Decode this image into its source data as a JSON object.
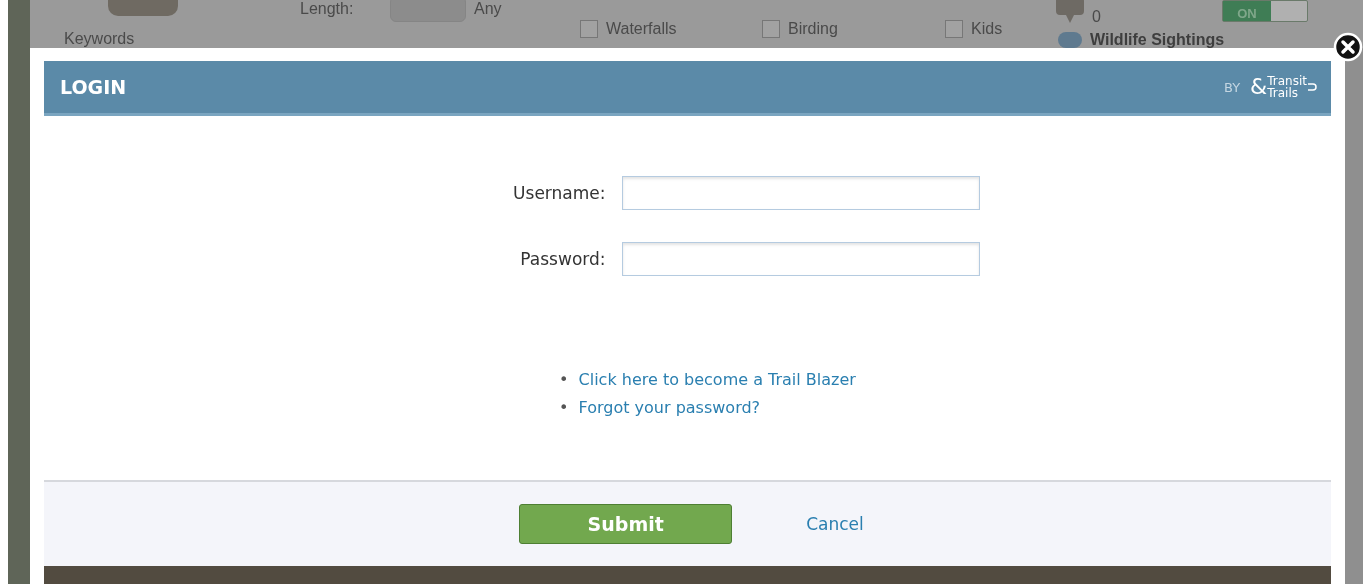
{
  "background_page": {
    "keywords_label": "Keywords",
    "length_label": "Length:",
    "length_value": "Any",
    "categories": [
      {
        "label": "Waterfalls",
        "checked": false
      },
      {
        "label": "Birding",
        "checked": false
      },
      {
        "label": "Kids",
        "checked": false
      }
    ],
    "comment_count": "0",
    "wildlife_label": "Wildlife Sightings",
    "toggle": {
      "label": "ON",
      "on": true
    }
  },
  "dialog": {
    "title": "LOGIN",
    "by": "BY",
    "logo": {
      "ampersand": "&",
      "top": "Transit",
      "bottom": "Trails"
    },
    "fields": [
      {
        "label": "Username:"
      },
      {
        "label": "Password:"
      }
    ],
    "links": [
      {
        "marker": "•",
        "text": "Click here to become a Trail Blazer"
      },
      {
        "marker": "•",
        "text": "Forgot your password?"
      }
    ],
    "submit": "Submit",
    "cancel": "Cancel"
  }
}
